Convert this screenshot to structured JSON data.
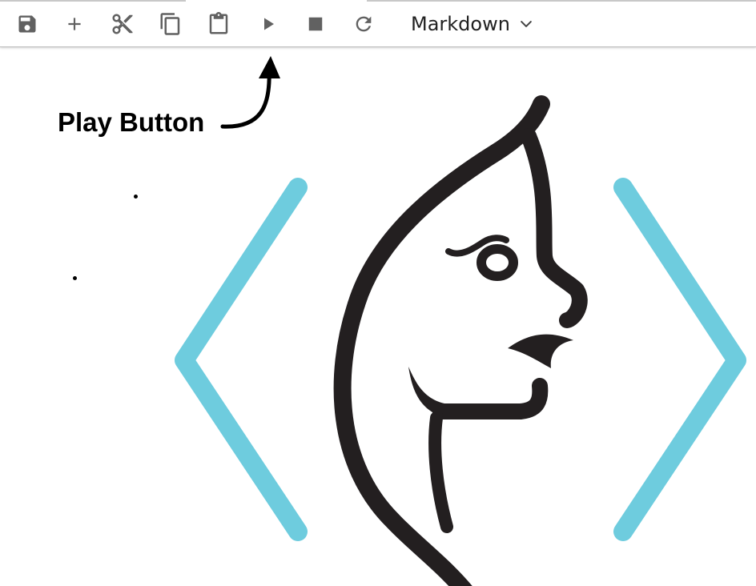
{
  "toolbar": {
    "buttons": [
      {
        "name": "save",
        "icon": "save-icon"
      },
      {
        "name": "insert-cell",
        "icon": "plus-icon"
      },
      {
        "name": "cut",
        "icon": "scissors-icon"
      },
      {
        "name": "copy",
        "icon": "copy-icon"
      },
      {
        "name": "paste",
        "icon": "clipboard-icon"
      },
      {
        "name": "run",
        "icon": "play-icon"
      },
      {
        "name": "interrupt",
        "icon": "stop-icon"
      },
      {
        "name": "restart",
        "icon": "refresh-icon"
      }
    ],
    "cell_type": {
      "selected": "Markdown",
      "icon": "chevron-down-icon"
    },
    "icon_color": "#616161"
  },
  "annotation": {
    "label": "Play Button"
  },
  "logo": {
    "bracket_color": "#6ECCDE",
    "figure_color": "#231F20"
  }
}
